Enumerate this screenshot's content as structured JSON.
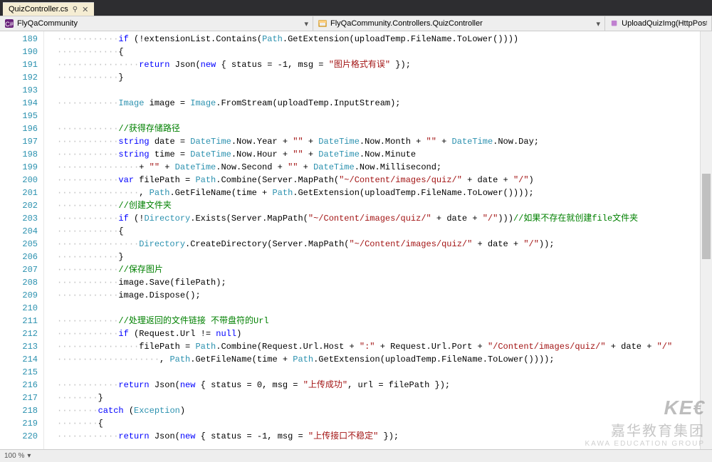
{
  "tab": {
    "filename": "QuizController.cs",
    "pin": "📌",
    "close": "✕"
  },
  "nav": {
    "project": "FlyQaCommunity",
    "class": "FlyQaCommunity.Controllers.QuizController",
    "method": "UploadQuizImg(HttpPoste"
  },
  "firstLine": 189,
  "code": [
    [
      [
        "dots",
        "············"
      ],
      [
        "kw",
        "if"
      ],
      [
        "txt",
        " (!extensionList.Contains("
      ],
      [
        "type",
        "Path"
      ],
      [
        "txt",
        ".GetExtension(uploadTemp.FileName.ToLower())))"
      ]
    ],
    [
      [
        "dots",
        "············"
      ],
      [
        "txt",
        "{"
      ]
    ],
    [
      [
        "dots",
        "················"
      ],
      [
        "kw",
        "return"
      ],
      [
        "txt",
        " Json("
      ],
      [
        "kw",
        "new"
      ],
      [
        "txt",
        " { status = -1, msg = "
      ],
      [
        "str",
        "\"图片格式有误\""
      ],
      [
        "txt",
        " });"
      ]
    ],
    [
      [
        "dots",
        "············"
      ],
      [
        "txt",
        "}"
      ]
    ],
    [
      [
        "txt",
        ""
      ]
    ],
    [
      [
        "dots",
        "············"
      ],
      [
        "type",
        "Image"
      ],
      [
        "txt",
        " image = "
      ],
      [
        "type",
        "Image"
      ],
      [
        "txt",
        ".FromStream(uploadTemp.InputStream);"
      ]
    ],
    [
      [
        "txt",
        ""
      ]
    ],
    [
      [
        "dots",
        "············"
      ],
      [
        "cmt",
        "//获得存储路径"
      ]
    ],
    [
      [
        "dots",
        "············"
      ],
      [
        "kw",
        "string"
      ],
      [
        "txt",
        " date = "
      ],
      [
        "type",
        "DateTime"
      ],
      [
        "txt",
        ".Now.Year + "
      ],
      [
        "str",
        "\"\""
      ],
      [
        "txt",
        " + "
      ],
      [
        "type",
        "DateTime"
      ],
      [
        "txt",
        ".Now.Month + "
      ],
      [
        "str",
        "\"\""
      ],
      [
        "txt",
        " + "
      ],
      [
        "type",
        "DateTime"
      ],
      [
        "txt",
        ".Now.Day;"
      ]
    ],
    [
      [
        "dots",
        "············"
      ],
      [
        "kw",
        "string"
      ],
      [
        "txt",
        " time = "
      ],
      [
        "type",
        "DateTime"
      ],
      [
        "txt",
        ".Now.Hour + "
      ],
      [
        "str",
        "\"\""
      ],
      [
        "txt",
        " + "
      ],
      [
        "type",
        "DateTime"
      ],
      [
        "txt",
        ".Now.Minute"
      ]
    ],
    [
      [
        "dots",
        "················"
      ],
      [
        "txt",
        "+ "
      ],
      [
        "str",
        "\"\""
      ],
      [
        "txt",
        " + "
      ],
      [
        "type",
        "DateTime"
      ],
      [
        "txt",
        ".Now.Second + "
      ],
      [
        "str",
        "\"\""
      ],
      [
        "txt",
        " + "
      ],
      [
        "type",
        "DateTime"
      ],
      [
        "txt",
        ".Now.Millisecond;"
      ]
    ],
    [
      [
        "dots",
        "············"
      ],
      [
        "kw",
        "var"
      ],
      [
        "txt",
        " filePath = "
      ],
      [
        "type",
        "Path"
      ],
      [
        "txt",
        ".Combine(Server.MapPath("
      ],
      [
        "str",
        "\"~/Content/images/quiz/\""
      ],
      [
        "txt",
        " + date + "
      ],
      [
        "str",
        "\"/\""
      ],
      [
        "txt",
        ")"
      ]
    ],
    [
      [
        "dots",
        "················"
      ],
      [
        "txt",
        ", "
      ],
      [
        "type",
        "Path"
      ],
      [
        "txt",
        ".GetFileName(time + "
      ],
      [
        "type",
        "Path"
      ],
      [
        "txt",
        ".GetExtension(uploadTemp.FileName.ToLower())));"
      ]
    ],
    [
      [
        "dots",
        "············"
      ],
      [
        "cmt",
        "//创建文件夹"
      ]
    ],
    [
      [
        "dots",
        "············"
      ],
      [
        "kw",
        "if"
      ],
      [
        "txt",
        " (!"
      ],
      [
        "type",
        "Directory"
      ],
      [
        "txt",
        ".Exists(Server.MapPath("
      ],
      [
        "str",
        "\"~/Content/images/quiz/\""
      ],
      [
        "txt",
        " + date + "
      ],
      [
        "str",
        "\"/\""
      ],
      [
        "txt",
        ")))"
      ],
      [
        "cmt",
        "//如果不存在就创建file文件夹"
      ]
    ],
    [
      [
        "dots",
        "············"
      ],
      [
        "txt",
        "{"
      ]
    ],
    [
      [
        "dots",
        "················"
      ],
      [
        "type",
        "Directory"
      ],
      [
        "txt",
        ".CreateDirectory(Server.MapPath("
      ],
      [
        "str",
        "\"~/Content/images/quiz/\""
      ],
      [
        "txt",
        " + date + "
      ],
      [
        "str",
        "\"/\""
      ],
      [
        "txt",
        "));"
      ]
    ],
    [
      [
        "dots",
        "············"
      ],
      [
        "txt",
        "}"
      ]
    ],
    [
      [
        "dots",
        "············"
      ],
      [
        "cmt",
        "//保存图片"
      ]
    ],
    [
      [
        "dots",
        "············"
      ],
      [
        "txt",
        "image.Save(filePath);"
      ]
    ],
    [
      [
        "dots",
        "············"
      ],
      [
        "txt",
        "image.Dispose();"
      ]
    ],
    [
      [
        "txt",
        ""
      ]
    ],
    [
      [
        "dots",
        "············"
      ],
      [
        "cmt",
        "//处理返回的文件链接 不带盘符的Url"
      ]
    ],
    [
      [
        "dots",
        "············"
      ],
      [
        "kw",
        "if"
      ],
      [
        "txt",
        " (Request.Url != "
      ],
      [
        "kw",
        "null"
      ],
      [
        "txt",
        ")"
      ]
    ],
    [
      [
        "dots",
        "················"
      ],
      [
        "txt",
        "filePath = "
      ],
      [
        "type",
        "Path"
      ],
      [
        "txt",
        ".Combine(Request.Url.Host + "
      ],
      [
        "str",
        "\":\""
      ],
      [
        "txt",
        " + Request.Url.Port + "
      ],
      [
        "str",
        "\"/Content/images/quiz/\""
      ],
      [
        "txt",
        " + date + "
      ],
      [
        "str",
        "\"/\""
      ]
    ],
    [
      [
        "dots",
        "····················"
      ],
      [
        "txt",
        ", "
      ],
      [
        "type",
        "Path"
      ],
      [
        "txt",
        ".GetFileName(time + "
      ],
      [
        "type",
        "Path"
      ],
      [
        "txt",
        ".GetExtension(uploadTemp.FileName.ToLower())));"
      ]
    ],
    [
      [
        "txt",
        ""
      ]
    ],
    [
      [
        "dots",
        "············"
      ],
      [
        "kw",
        "return"
      ],
      [
        "txt",
        " Json("
      ],
      [
        "kw",
        "new"
      ],
      [
        "txt",
        " { status = 0, msg = "
      ],
      [
        "str",
        "\"上传成功\""
      ],
      [
        "txt",
        ", url = filePath });"
      ]
    ],
    [
      [
        "dots",
        "········"
      ],
      [
        "txt",
        "}"
      ]
    ],
    [
      [
        "dots",
        "········"
      ],
      [
        "kw",
        "catch"
      ],
      [
        "txt",
        " ("
      ],
      [
        "type",
        "Exception"
      ],
      [
        "txt",
        ")"
      ]
    ],
    [
      [
        "dots",
        "········"
      ],
      [
        "txt",
        "{"
      ]
    ],
    [
      [
        "dots",
        "············"
      ],
      [
        "kw",
        "return"
      ],
      [
        "txt",
        " Json("
      ],
      [
        "kw",
        "new"
      ],
      [
        "txt",
        " { status = -1, msg = "
      ],
      [
        "str",
        "\"上传接口不稳定\""
      ],
      [
        "txt",
        " });"
      ]
    ]
  ],
  "status": {
    "zoom": "100 %"
  },
  "watermark": {
    "logo": "KE€",
    "cn": "嘉华教育集团",
    "en": "KAWA EDUCATION GROUP"
  }
}
